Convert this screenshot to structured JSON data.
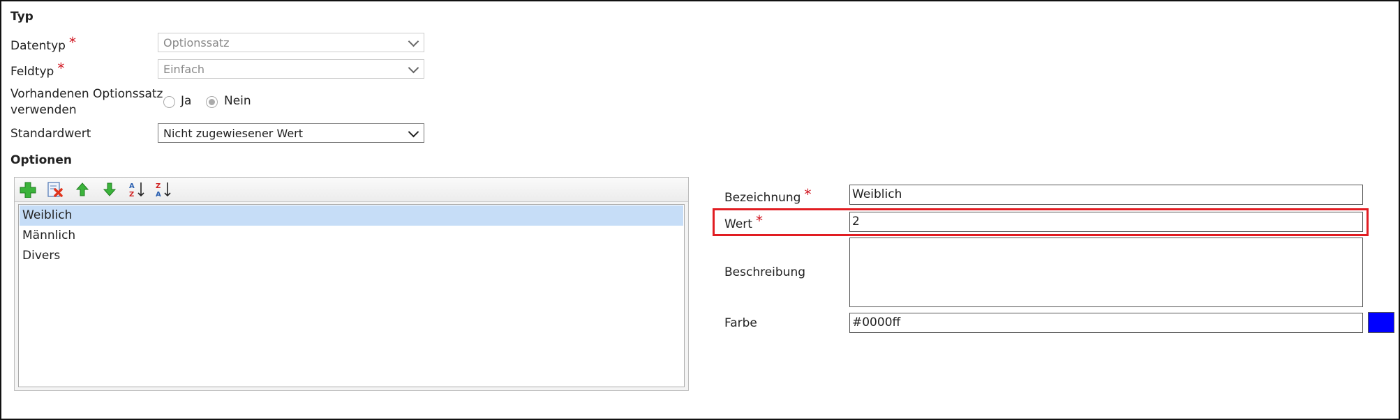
{
  "type_section": {
    "title": "Typ"
  },
  "datatype": {
    "label": "Datentyp",
    "value": "Optionssatz"
  },
  "fieldtype": {
    "label": "Feldtyp",
    "value": "Einfach"
  },
  "existing_optionset": {
    "label_line1": "Vorhandenen Optionssatz",
    "label_line2": "verwenden",
    "option_yes": "Ja",
    "option_no": "Nein",
    "selected": "Nein"
  },
  "default_value": {
    "label": "Standardwert",
    "value": "Nicht zugewiesener Wert"
  },
  "options_section": {
    "title": "Optionen"
  },
  "options": {
    "items": [
      "Weiblich",
      "Männlich",
      "Divers"
    ],
    "selected_index": 0
  },
  "details": {
    "label_label": "Bezeichnung",
    "label_value": "Weiblich",
    "value_label": "Wert",
    "value_value": "2",
    "description_label": "Beschreibung",
    "description_value": "",
    "color_label": "Farbe",
    "color_value": "#0000ff"
  },
  "colors": {
    "highlight": "#e11d22",
    "required": "#d0141f",
    "selection": "#c6ddf7",
    "swatch": "#0000ff"
  },
  "toolbar_icons": [
    "add-icon",
    "delete-icon",
    "move-up-icon",
    "move-down-icon",
    "sort-ascending-icon",
    "sort-descending-icon"
  ]
}
